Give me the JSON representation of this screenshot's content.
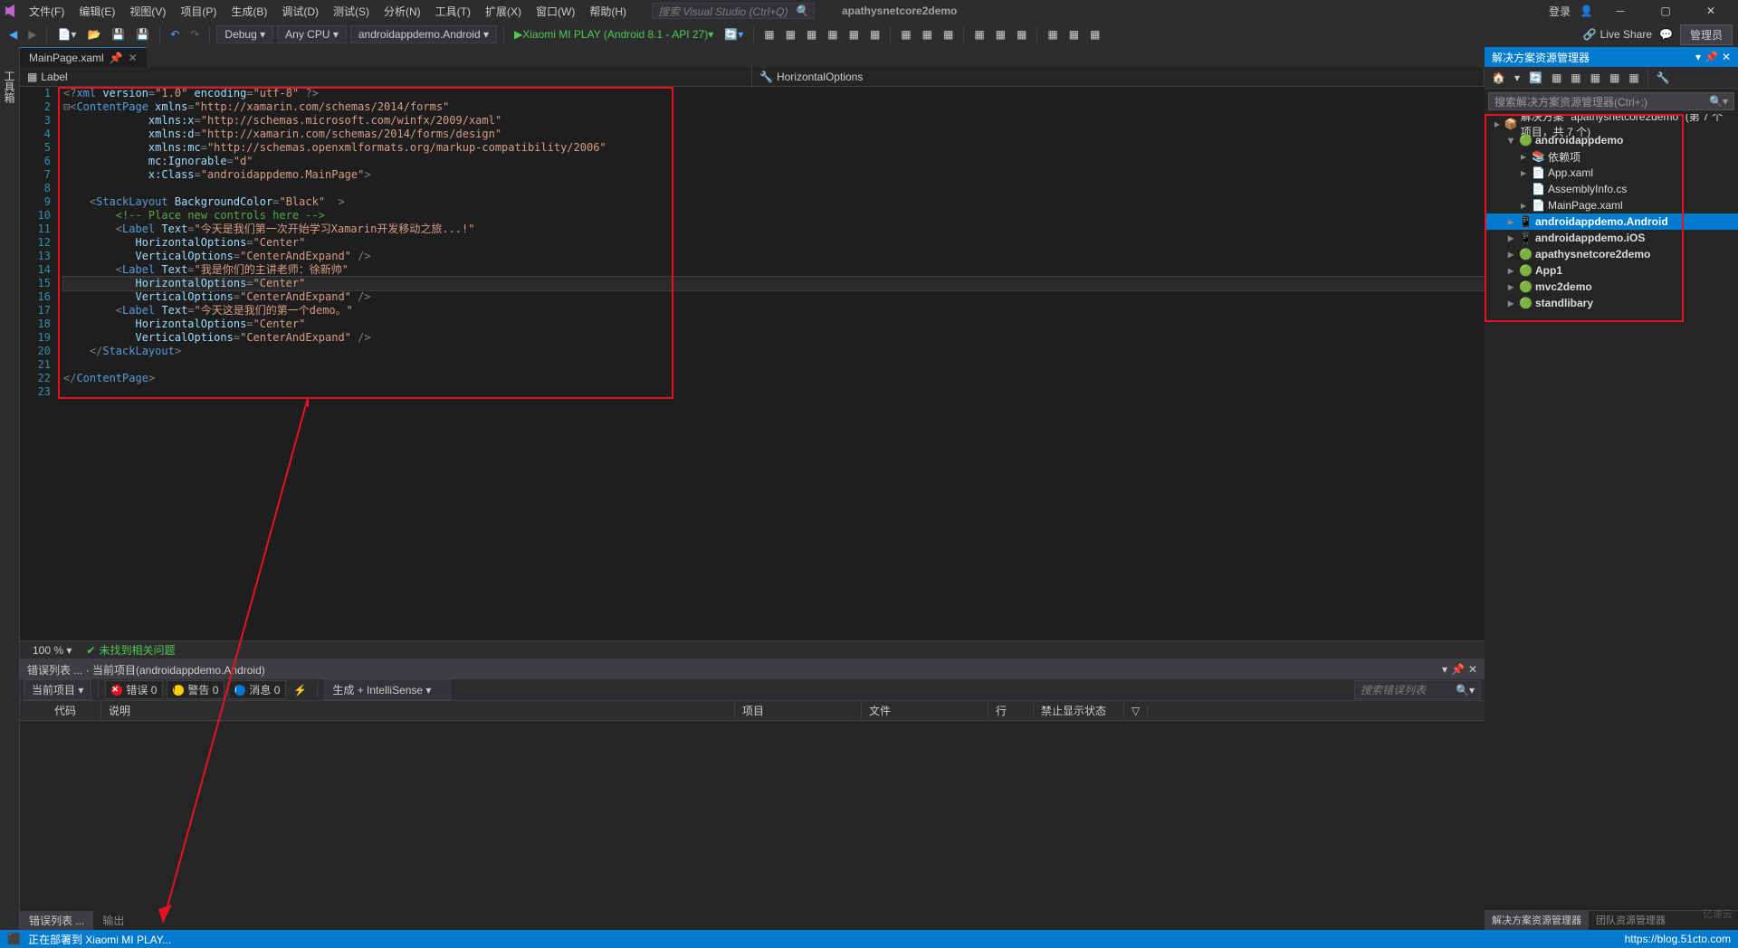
{
  "app": {
    "project_name": "apathysnetcore2demo",
    "search_placeholder": "搜索 Visual Studio (Ctrl+Q)",
    "login": "登录"
  },
  "menu": [
    "文件(F)",
    "编辑(E)",
    "视图(V)",
    "项目(P)",
    "生成(B)",
    "调试(D)",
    "测试(S)",
    "分析(N)",
    "工具(T)",
    "扩展(X)",
    "窗口(W)",
    "帮助(H)"
  ],
  "toolbar": {
    "config": "Debug",
    "platform": "Any CPU",
    "startup": "androidappdemo.Android",
    "device": "Xiaomi MI PLAY (Android 8.1 - API 27)",
    "liveshare": "Live Share",
    "admin": "管理员"
  },
  "tabs": [
    {
      "name": "MainPage.xaml",
      "active": true
    }
  ],
  "navbar": {
    "left": "Label",
    "right": "HorizontalOptions"
  },
  "editor": {
    "zoom": "100 %",
    "no_issues": "未找到相关问题",
    "lines": [
      {
        "n": 1,
        "html": "<span class='punc'>&lt;?</span><span class='elem'>xml</span> <span class='attr'>version</span><span class='punc'>=</span><span class='str'>\"1.0\"</span> <span class='attr'>encoding</span><span class='punc'>=</span><span class='str'>\"utf-8\"</span> <span class='punc'>?&gt;</span>"
      },
      {
        "n": 2,
        "html": "<span class='punc'>⊟&lt;</span><span class='elem'>ContentPage</span> <span class='attr'>xmlns</span><span class='punc'>=</span><span class='str'>\"http://xamarin.com/schemas/2014/forms\"</span>"
      },
      {
        "n": 3,
        "html": "             <span class='attr'>xmlns:x</span><span class='punc'>=</span><span class='str'>\"http://schemas.microsoft.com/winfx/2009/xaml\"</span>"
      },
      {
        "n": 4,
        "html": "             <span class='attr'>xmlns:d</span><span class='punc'>=</span><span class='str'>\"http://xamarin.com/schemas/2014/forms/design\"</span>"
      },
      {
        "n": 5,
        "html": "             <span class='attr'>xmlns:mc</span><span class='punc'>=</span><span class='str'>\"http://schemas.openxmlformats.org/markup-compatibility/2006\"</span>"
      },
      {
        "n": 6,
        "html": "             <span class='attr'>mc:Ignorable</span><span class='punc'>=</span><span class='str'>\"d\"</span>"
      },
      {
        "n": 7,
        "html": "             <span class='attr'>x:Class</span><span class='punc'>=</span><span class='str'>\"androidappdemo.MainPage\"</span><span class='punc'>&gt;</span>"
      },
      {
        "n": 8,
        "html": ""
      },
      {
        "n": 9,
        "html": "    <span class='punc'>&lt;</span><span class='elem'>StackLayout</span> <span class='attr'>BackgroundColor</span><span class='punc'>=</span><span class='str'>\"Black\"</span>  <span class='punc'>&gt;</span>"
      },
      {
        "n": 10,
        "html": "        <span class='cmt'>&lt;!-- Place new controls here --&gt;</span>"
      },
      {
        "n": 11,
        "html": "        <span class='punc'>&lt;</span><span class='elem'>Label</span> <span class='attr'>Text</span><span class='punc'>=</span><span class='str'>\"今天是我们第一次开始学习Xamarin开发移动之旅...!\"</span>"
      },
      {
        "n": 12,
        "html": "           <span class='attr'>HorizontalOptions</span><span class='punc'>=</span><span class='str'>\"Center\"</span>"
      },
      {
        "n": 13,
        "html": "           <span class='attr'>VerticalOptions</span><span class='punc'>=</span><span class='str'>\"CenterAndExpand\"</span> <span class='punc'>/&gt;</span>"
      },
      {
        "n": 14,
        "html": "        <span class='punc'>&lt;</span><span class='elem'>Label</span> <span class='attr'>Text</span><span class='punc'>=</span><span class='str'>\"我是你们的主讲老师：徐新帅\"</span>"
      },
      {
        "n": 15,
        "html": "           <span class='attr'>HorizontalOptions</span><span class='punc'>=</span><span class='str'>\"Center\"</span>",
        "current": true
      },
      {
        "n": 16,
        "html": "           <span class='attr'>VerticalOptions</span><span class='punc'>=</span><span class='str'>\"CenterAndExpand\"</span> <span class='punc'>/&gt;</span>"
      },
      {
        "n": 17,
        "html": "        <span class='punc'>&lt;</span><span class='elem'>Label</span> <span class='attr'>Text</span><span class='punc'>=</span><span class='str'>\"今天这是我们的第一个demo。\"</span>"
      },
      {
        "n": 18,
        "html": "           <span class='attr'>HorizontalOptions</span><span class='punc'>=</span><span class='str'>\"Center\"</span>"
      },
      {
        "n": 19,
        "html": "           <span class='attr'>VerticalOptions</span><span class='punc'>=</span><span class='str'>\"CenterAndExpand\"</span> <span class='punc'>/&gt;</span>"
      },
      {
        "n": 20,
        "html": "    <span class='punc'>&lt;/</span><span class='elem'>StackLayout</span><span class='punc'>&gt;</span>"
      },
      {
        "n": 21,
        "html": ""
      },
      {
        "n": 22,
        "html": "<span class='punc'>&lt;/</span><span class='elem'>ContentPage</span><span class='punc'>&gt;</span>"
      },
      {
        "n": 23,
        "html": ""
      }
    ]
  },
  "error_panel": {
    "title": "错误列表 ... · 当前项目(androidappdemo.Android)",
    "scope": "当前项目",
    "errors": "错误 0",
    "warnings": "警告 0",
    "messages": "消息 0",
    "build": "生成 + IntelliSense",
    "search_placeholder": "搜索错误列表",
    "cols": [
      "",
      "代码",
      "说明",
      "项目",
      "文件",
      "行",
      "禁止显示状态"
    ],
    "tabs": [
      "错误列表 ...",
      "输出"
    ]
  },
  "solution": {
    "title": "解决方案资源管理器",
    "search_placeholder": "搜索解决方案资源管理器(Ctrl+;)",
    "root": "解决方案 \"apathysnetcore2demo\" (第 7 个项目，共 7 个)",
    "tree": [
      {
        "depth": 0,
        "arrow": "▸",
        "icon": "sln",
        "label": "解决方案 \"apathysnetcore2demo\" (第 7 个项目，共 7 个)",
        "bold": false
      },
      {
        "depth": 1,
        "arrow": "▾",
        "icon": "csproj",
        "label": "androidappdemo",
        "bold": true
      },
      {
        "depth": 2,
        "arrow": "▸",
        "icon": "dep",
        "label": "依赖项"
      },
      {
        "depth": 2,
        "arrow": "▸",
        "icon": "xaml",
        "label": "App.xaml"
      },
      {
        "depth": 2,
        "arrow": "",
        "icon": "cs",
        "label": "AssemblyInfo.cs"
      },
      {
        "depth": 2,
        "arrow": "▸",
        "icon": "xaml",
        "label": "MainPage.xaml"
      },
      {
        "depth": 1,
        "arrow": "▸",
        "icon": "android",
        "label": "androidappdemo.Android",
        "bold": true,
        "selected": true
      },
      {
        "depth": 1,
        "arrow": "▸",
        "icon": "ios",
        "label": "androidappdemo.iOS",
        "bold": true
      },
      {
        "depth": 1,
        "arrow": "▸",
        "icon": "csproj",
        "label": "apathysnetcore2demo",
        "bold": true
      },
      {
        "depth": 1,
        "arrow": "▸",
        "icon": "csproj",
        "label": "App1",
        "bold": true
      },
      {
        "depth": 1,
        "arrow": "▸",
        "icon": "csproj",
        "label": "mvc2demo",
        "bold": true
      },
      {
        "depth": 1,
        "arrow": "▸",
        "icon": "csproj",
        "label": "standlibary",
        "bold": true
      }
    ],
    "tabs": [
      "解决方案资源管理器",
      "团队资源管理器"
    ]
  },
  "statusbar": {
    "text": "正在部署到 Xiaomi MI PLAY...",
    "url": "https://blog.51cto.com"
  },
  "watermark": "亿速云"
}
